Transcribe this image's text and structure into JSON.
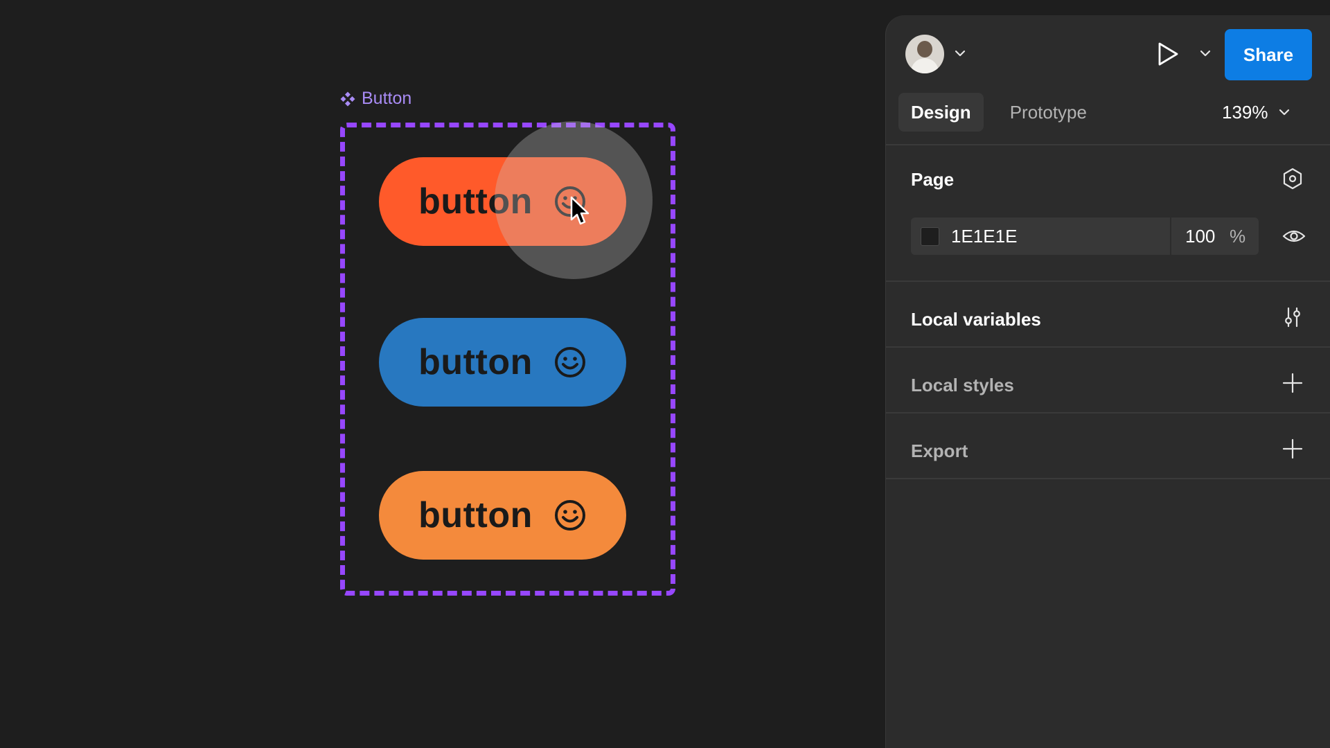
{
  "canvas": {
    "component_label": "Button",
    "variants": [
      {
        "label": "button",
        "color": "#ff5a2a"
      },
      {
        "label": "button",
        "color": "#2878c0"
      },
      {
        "label": "button",
        "color": "#f48a3c"
      }
    ],
    "frame_stroke_color": "#9747ff",
    "background_color": "#1e1e1e"
  },
  "panel": {
    "share_label": "Share",
    "tabs": [
      {
        "label": "Design",
        "active": true
      },
      {
        "label": "Prototype",
        "active": false
      }
    ],
    "zoom": "139%",
    "page": {
      "title": "Page",
      "color_hex": "1E1E1E",
      "opacity": "100",
      "opacity_unit": "%"
    },
    "local_variables": {
      "title": "Local variables"
    },
    "local_styles": {
      "title": "Local styles"
    },
    "export": {
      "title": "Export"
    },
    "accent_color": "#0d7de4"
  }
}
